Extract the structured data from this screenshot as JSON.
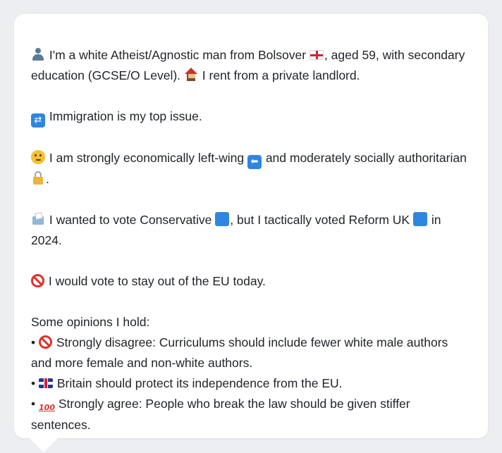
{
  "profile": {
    "intro_part1": " I'm a white Atheist/Agnostic man from Bolsover ",
    "intro_part2": ", aged 59, with secondary education (GCSE/O Level). ",
    "intro_part3": " I rent from a private landlord.",
    "top_issue": " Immigration is my top issue.",
    "ideology_part1": " I am strongly economically left-wing ",
    "ideology_part2": " and moderately socially authoritarian ",
    "ideology_part3": ".",
    "vote_part1": " I wanted to vote Conservative ",
    "vote_part2": ", but I tactically voted Reform UK ",
    "vote_part3": " in 2024.",
    "eu_stance": " I would vote to stay out of the EU today.",
    "opinions_heading": "Some opinions I hold:",
    "bullet_char": "•",
    "opinions": [
      {
        "text": " Strongly disagree: Curriculums should include fewer white male authors and more female and non-white authors.",
        "icon": "no-entry-icon"
      },
      {
        "text": " Britain should protect its independence from the EU.",
        "icon": "uk-flag-icon"
      },
      {
        "text": " Strongly agree: People who break the law should be given stiffer sentences.",
        "icon": "hundred-points-icon"
      }
    ]
  },
  "icons": {
    "immigration_glyph": "⇄",
    "left_arrow_glyph": "⬅",
    "hundred_glyph": "100"
  },
  "colors": {
    "background": "#eceef1",
    "card": "#ffffff",
    "text": "#1f2328",
    "accent_blue": "#2f86e0",
    "accent_red": "#e0312b"
  }
}
